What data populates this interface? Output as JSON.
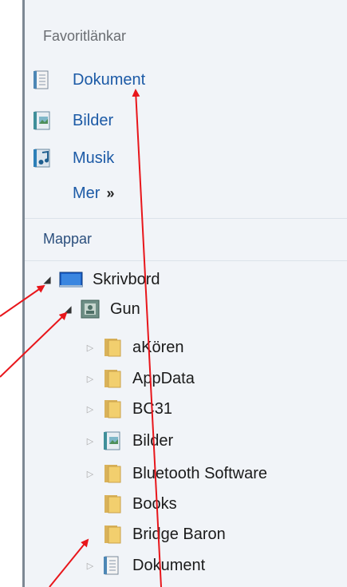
{
  "favorites": {
    "header": "Favoritlänkar",
    "items": [
      {
        "label": "Dokument",
        "icon": "document-library-icon"
      },
      {
        "label": "Bilder",
        "icon": "pictures-library-icon"
      },
      {
        "label": "Musik",
        "icon": "music-library-icon"
      }
    ],
    "more_label": "Mer",
    "more_chevron": "»"
  },
  "folders": {
    "header": "Mappar",
    "tree": [
      {
        "label": "Skrivbord",
        "icon": "desktop-icon",
        "expanded": true
      },
      {
        "label": "Gun",
        "icon": "user-folder-icon",
        "expanded": true
      },
      {
        "label": "aKören",
        "icon": "folder-icon",
        "expandable": true
      },
      {
        "label": "AppData",
        "icon": "folder-icon",
        "expandable": true
      },
      {
        "label": "BC31",
        "icon": "folder-icon",
        "expandable": true
      },
      {
        "label": "Bilder",
        "icon": "pictures-library-icon",
        "expandable": true
      },
      {
        "label": "Bluetooth Software",
        "icon": "folder-icon",
        "expandable": true
      },
      {
        "label": "Books",
        "icon": "folder-icon",
        "expandable": false
      },
      {
        "label": "Bridge Baron",
        "icon": "folder-icon",
        "expandable": false
      },
      {
        "label": "Dokument",
        "icon": "document-library-icon",
        "expandable": true
      }
    ]
  },
  "colors": {
    "pane_background": "#f1f4f8",
    "link_blue": "#1c5aa6",
    "annotation_red": "#e8161b",
    "folder_yellow": "#f0c95c"
  }
}
